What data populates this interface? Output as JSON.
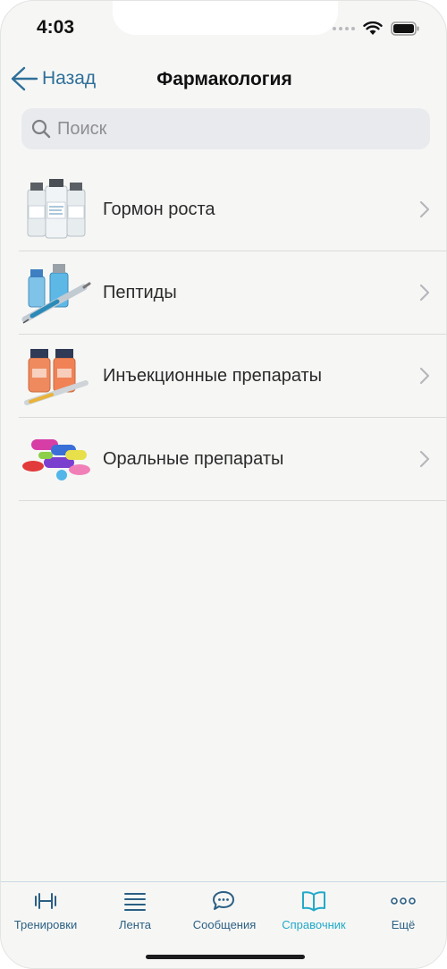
{
  "status": {
    "time": "4:03"
  },
  "nav": {
    "back_label": "Назад",
    "title": "Фармакология"
  },
  "search": {
    "placeholder": "Поиск",
    "value": ""
  },
  "categories": [
    {
      "label": "Гормон роста",
      "icon": "vials-icon"
    },
    {
      "label": "Пептиды",
      "icon": "vial-syringe-icon"
    },
    {
      "label": "Инъекционные препараты",
      "icon": "injection-vials-icon"
    },
    {
      "label": "Оральные препараты",
      "icon": "pills-icon"
    }
  ],
  "tabs": [
    {
      "label": "Тренировки",
      "icon": "dumbbell-icon",
      "active": false
    },
    {
      "label": "Лента",
      "icon": "feed-lines-icon",
      "active": false
    },
    {
      "label": "Сообщения",
      "icon": "chat-bubbles-icon",
      "active": false
    },
    {
      "label": "Справочник",
      "icon": "book-icon",
      "active": true
    },
    {
      "label": "Ещё",
      "icon": "more-dots-icon",
      "active": false
    }
  ],
  "colors": {
    "accent": "#2f6f99",
    "active_tab": "#22a9c9",
    "background": "#f6f7f5"
  }
}
